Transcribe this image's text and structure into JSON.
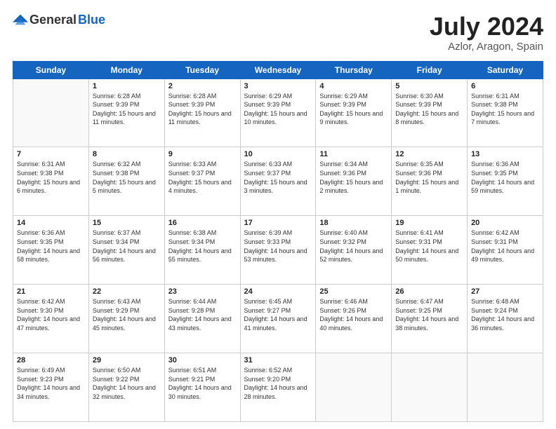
{
  "header": {
    "logo_general": "General",
    "logo_blue": "Blue",
    "title": "July 2024",
    "location": "Azlor, Aragon, Spain"
  },
  "weekdays": [
    "Sunday",
    "Monday",
    "Tuesday",
    "Wednesday",
    "Thursday",
    "Friday",
    "Saturday"
  ],
  "weeks": [
    [
      {
        "day": "",
        "sunrise": "",
        "sunset": "",
        "daylight": ""
      },
      {
        "day": "1",
        "sunrise": "Sunrise: 6:28 AM",
        "sunset": "Sunset: 9:39 PM",
        "daylight": "Daylight: 15 hours and 11 minutes."
      },
      {
        "day": "2",
        "sunrise": "Sunrise: 6:28 AM",
        "sunset": "Sunset: 9:39 PM",
        "daylight": "Daylight: 15 hours and 11 minutes."
      },
      {
        "day": "3",
        "sunrise": "Sunrise: 6:29 AM",
        "sunset": "Sunset: 9:39 PM",
        "daylight": "Daylight: 15 hours and 10 minutes."
      },
      {
        "day": "4",
        "sunrise": "Sunrise: 6:29 AM",
        "sunset": "Sunset: 9:39 PM",
        "daylight": "Daylight: 15 hours and 9 minutes."
      },
      {
        "day": "5",
        "sunrise": "Sunrise: 6:30 AM",
        "sunset": "Sunset: 9:39 PM",
        "daylight": "Daylight: 15 hours and 8 minutes."
      },
      {
        "day": "6",
        "sunrise": "Sunrise: 6:31 AM",
        "sunset": "Sunset: 9:38 PM",
        "daylight": "Daylight: 15 hours and 7 minutes."
      }
    ],
    [
      {
        "day": "7",
        "sunrise": "Sunrise: 6:31 AM",
        "sunset": "Sunset: 9:38 PM",
        "daylight": "Daylight: 15 hours and 6 minutes."
      },
      {
        "day": "8",
        "sunrise": "Sunrise: 6:32 AM",
        "sunset": "Sunset: 9:38 PM",
        "daylight": "Daylight: 15 hours and 5 minutes."
      },
      {
        "day": "9",
        "sunrise": "Sunrise: 6:33 AM",
        "sunset": "Sunset: 9:37 PM",
        "daylight": "Daylight: 15 hours and 4 minutes."
      },
      {
        "day": "10",
        "sunrise": "Sunrise: 6:33 AM",
        "sunset": "Sunset: 9:37 PM",
        "daylight": "Daylight: 15 hours and 3 minutes."
      },
      {
        "day": "11",
        "sunrise": "Sunrise: 6:34 AM",
        "sunset": "Sunset: 9:36 PM",
        "daylight": "Daylight: 15 hours and 2 minutes."
      },
      {
        "day": "12",
        "sunrise": "Sunrise: 6:35 AM",
        "sunset": "Sunset: 9:36 PM",
        "daylight": "Daylight: 15 hours and 1 minute."
      },
      {
        "day": "13",
        "sunrise": "Sunrise: 6:36 AM",
        "sunset": "Sunset: 9:35 PM",
        "daylight": "Daylight: 14 hours and 59 minutes."
      }
    ],
    [
      {
        "day": "14",
        "sunrise": "Sunrise: 6:36 AM",
        "sunset": "Sunset: 9:35 PM",
        "daylight": "Daylight: 14 hours and 58 minutes."
      },
      {
        "day": "15",
        "sunrise": "Sunrise: 6:37 AM",
        "sunset": "Sunset: 9:34 PM",
        "daylight": "Daylight: 14 hours and 56 minutes."
      },
      {
        "day": "16",
        "sunrise": "Sunrise: 6:38 AM",
        "sunset": "Sunset: 9:34 PM",
        "daylight": "Daylight: 14 hours and 55 minutes."
      },
      {
        "day": "17",
        "sunrise": "Sunrise: 6:39 AM",
        "sunset": "Sunset: 9:33 PM",
        "daylight": "Daylight: 14 hours and 53 minutes."
      },
      {
        "day": "18",
        "sunrise": "Sunrise: 6:40 AM",
        "sunset": "Sunset: 9:32 PM",
        "daylight": "Daylight: 14 hours and 52 minutes."
      },
      {
        "day": "19",
        "sunrise": "Sunrise: 6:41 AM",
        "sunset": "Sunset: 9:31 PM",
        "daylight": "Daylight: 14 hours and 50 minutes."
      },
      {
        "day": "20",
        "sunrise": "Sunrise: 6:42 AM",
        "sunset": "Sunset: 9:31 PM",
        "daylight": "Daylight: 14 hours and 49 minutes."
      }
    ],
    [
      {
        "day": "21",
        "sunrise": "Sunrise: 6:42 AM",
        "sunset": "Sunset: 9:30 PM",
        "daylight": "Daylight: 14 hours and 47 minutes."
      },
      {
        "day": "22",
        "sunrise": "Sunrise: 6:43 AM",
        "sunset": "Sunset: 9:29 PM",
        "daylight": "Daylight: 14 hours and 45 minutes."
      },
      {
        "day": "23",
        "sunrise": "Sunrise: 6:44 AM",
        "sunset": "Sunset: 9:28 PM",
        "daylight": "Daylight: 14 hours and 43 minutes."
      },
      {
        "day": "24",
        "sunrise": "Sunrise: 6:45 AM",
        "sunset": "Sunset: 9:27 PM",
        "daylight": "Daylight: 14 hours and 41 minutes."
      },
      {
        "day": "25",
        "sunrise": "Sunrise: 6:46 AM",
        "sunset": "Sunset: 9:26 PM",
        "daylight": "Daylight: 14 hours and 40 minutes."
      },
      {
        "day": "26",
        "sunrise": "Sunrise: 6:47 AM",
        "sunset": "Sunset: 9:25 PM",
        "daylight": "Daylight: 14 hours and 38 minutes."
      },
      {
        "day": "27",
        "sunrise": "Sunrise: 6:48 AM",
        "sunset": "Sunset: 9:24 PM",
        "daylight": "Daylight: 14 hours and 36 minutes."
      }
    ],
    [
      {
        "day": "28",
        "sunrise": "Sunrise: 6:49 AM",
        "sunset": "Sunset: 9:23 PM",
        "daylight": "Daylight: 14 hours and 34 minutes."
      },
      {
        "day": "29",
        "sunrise": "Sunrise: 6:50 AM",
        "sunset": "Sunset: 9:22 PM",
        "daylight": "Daylight: 14 hours and 32 minutes."
      },
      {
        "day": "30",
        "sunrise": "Sunrise: 6:51 AM",
        "sunset": "Sunset: 9:21 PM",
        "daylight": "Daylight: 14 hours and 30 minutes."
      },
      {
        "day": "31",
        "sunrise": "Sunrise: 6:52 AM",
        "sunset": "Sunset: 9:20 PM",
        "daylight": "Daylight: 14 hours and 28 minutes."
      },
      {
        "day": "",
        "sunrise": "",
        "sunset": "",
        "daylight": ""
      },
      {
        "day": "",
        "sunrise": "",
        "sunset": "",
        "daylight": ""
      },
      {
        "day": "",
        "sunrise": "",
        "sunset": "",
        "daylight": ""
      }
    ]
  ]
}
